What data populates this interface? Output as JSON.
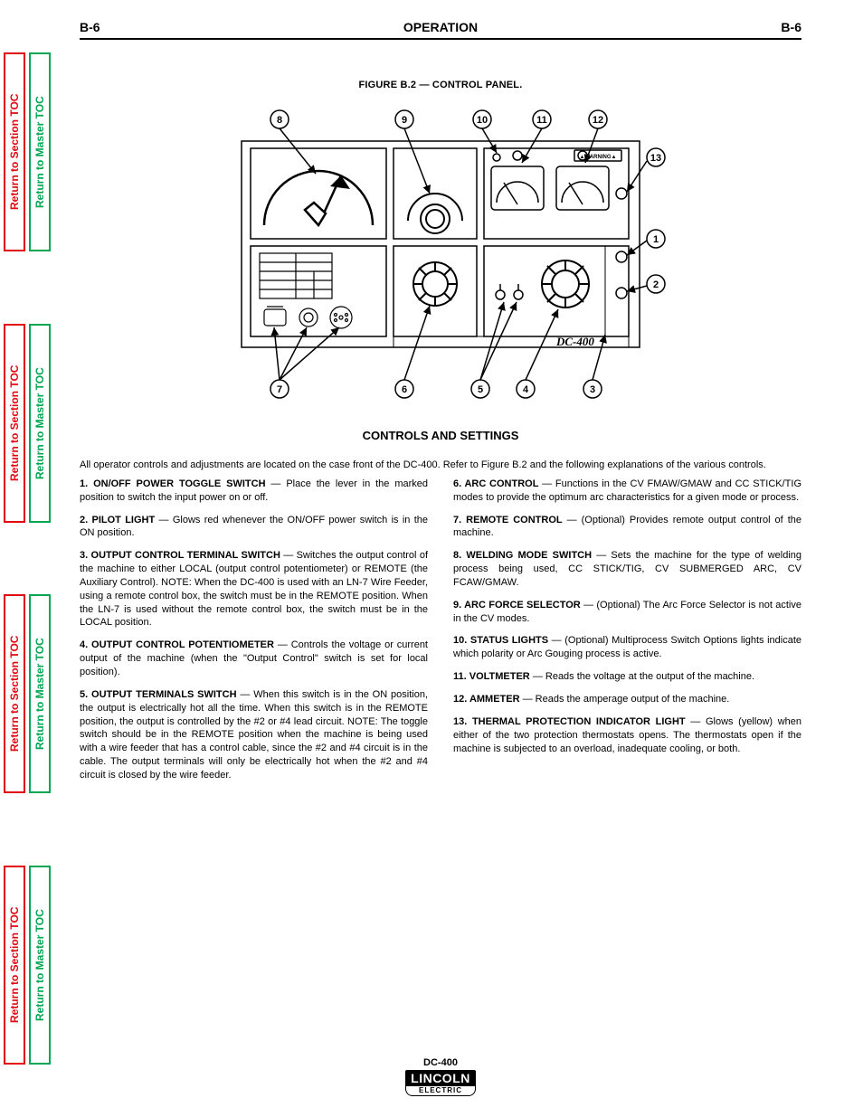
{
  "sideTabs": {
    "section": "Return to Section TOC",
    "master": "Return to Master TOC"
  },
  "header": {
    "leftCode": "B-6",
    "centerTitle": "OPERATION",
    "rightCode": "B-6"
  },
  "figure": {
    "title": "FIGURE B.2 — CONTROL PANEL.",
    "deviceLabel": "DC-400",
    "warningLabel": "WARNING",
    "callouts": [
      "1",
      "2",
      "3",
      "4",
      "5",
      "6",
      "7",
      "8",
      "9",
      "10",
      "11",
      "12",
      "13"
    ]
  },
  "controls": {
    "heading": "CONTROLS AND SETTINGS",
    "intro": "All operator controls and adjustments are located on the case front of the DC-400. Refer to Figure B.2 and the following explanations of the various controls.",
    "items": [
      {
        "label": "1. ON/OFF POWER TOGGLE SWITCH",
        "text": " — Place the lever in the marked position to switch the input power on or off."
      },
      {
        "label": "2. PILOT LIGHT",
        "text": " — Glows red whenever the ON/OFF power switch is in the ON position."
      },
      {
        "label": "3. OUTPUT CONTROL TERMINAL SWITCH",
        "text": " — Switches the output control of the machine to either LOCAL (output control potentiometer) or REMOTE (the Auxiliary Control). NOTE: When the DC-400 is used with an LN-7 Wire Feeder, using a remote control box, the switch must be in the REMOTE position. When the LN-7 is used without the remote control box, the switch must be in the LOCAL position."
      },
      {
        "label": "4. OUTPUT CONTROL POTENTIOMETER",
        "text": " — Controls the voltage or current output of the machine (when the \"Output Control\" switch is set for local position)."
      },
      {
        "label": "5. OUTPUT TERMINALS SWITCH",
        "text": " — When this switch is in the ON position, the output is electrically hot all the time. When this switch is in the REMOTE position, the output is controlled by the #2 or #4 lead circuit. NOTE: The toggle switch should be in the REMOTE position when the machine is being used with a wire feeder that has a control cable, since the #2 and #4 circuit is in the cable. The output terminals will only be electrically hot when the #2 and #4 circuit is closed by the wire feeder."
      },
      {
        "label": "6. ARC CONTROL",
        "text": " — Functions in the CV FMAW/GMAW and CC STICK/TIG modes to provide the optimum arc characteristics for a given mode or process."
      },
      {
        "label": "7. REMOTE CONTROL",
        "text": " — (Optional) Provides remote output control of the machine."
      },
      {
        "label": "8. WELDING MODE SWITCH",
        "text": " — Sets the machine for the type of welding process being used, CC STICK/TIG, CV SUBMERGED ARC, CV FCAW/GMAW."
      },
      {
        "label": "9. ARC FORCE SELECTOR",
        "text": " — (Optional) The Arc Force Selector is not active in the CV modes."
      },
      {
        "label": "10. STATUS LIGHTS",
        "text": " — (Optional) Multiprocess Switch Options lights indicate which polarity or Arc Gouging process is active."
      },
      {
        "label": "11. VOLTMETER",
        "text": " — Reads the voltage at the output of the machine."
      },
      {
        "label": "12. AMMETER",
        "text": " — Reads the amperage output of the machine."
      },
      {
        "label": "13. THERMAL PROTECTION INDICATOR LIGHT",
        "text": " — Glows (yellow) when either of the two protection thermostats opens. The thermostats open if the machine is subjected to an overload, inadequate cooling, or both."
      }
    ]
  },
  "footer": {
    "model": "DC-400",
    "logoTop": "LINCOLN",
    "logoBottom": "ELECTRIC"
  }
}
